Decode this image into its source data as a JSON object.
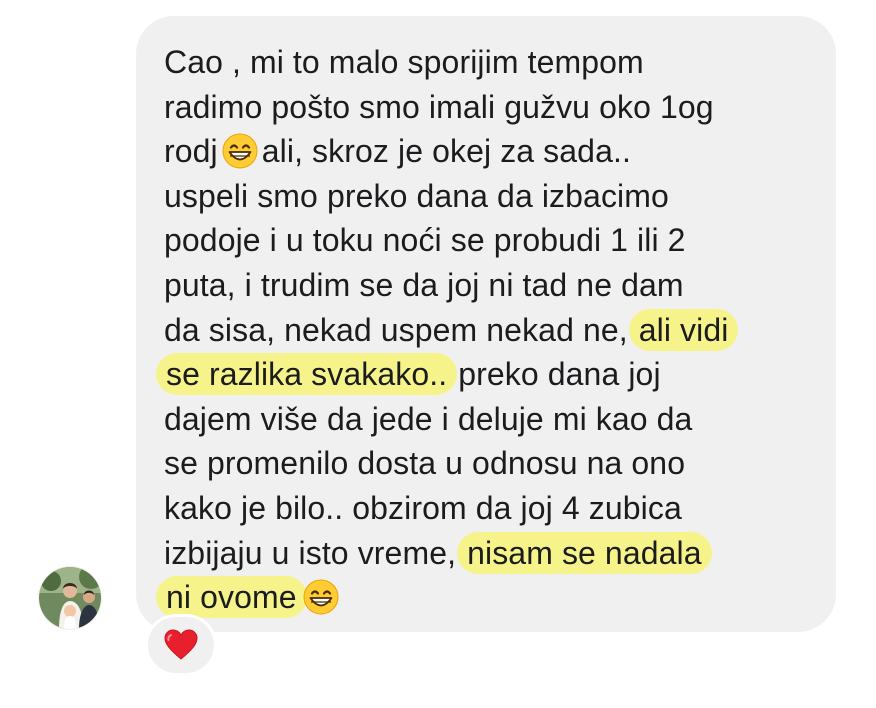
{
  "message": {
    "lines": [
      {
        "before": "Cao , mi to malo sporijim  tempom"
      },
      {
        "before": "radimo pošto smo imali gužvu oko 1og"
      },
      {
        "before": "rodj",
        "emoji": "grinning-face-emoji",
        "after": "ali, skroz je okej za sada.."
      },
      {
        "before": "uspeli smo preko dana da izbacimo"
      },
      {
        "before": "podoje  i u toku noći  se probudi 1 ili 2"
      },
      {
        "before": "puta, i trudim  se da joj ni tad ne dam"
      },
      {
        "before": "da sisa, nekad uspem nekad ne,",
        "highlight": "ali vidi"
      },
      {
        "highlight": "se razlika svakako..",
        "after": "preko dana joj"
      },
      {
        "before": "dajem više da jede i deluje mi kao da"
      },
      {
        "before": "se promenilo dosta u odnosu  na ono"
      },
      {
        "before": "kako je bilo.. obzirom da joj 4 zubica"
      },
      {
        "before": "izbijaju u isto vreme,",
        "highlight": "nisam se nadala"
      },
      {
        "highlight": "ni ovome",
        "emoji": "grinning-face-emoji"
      }
    ]
  },
  "reaction": {
    "icon": "heart-icon",
    "color": "#e8202e"
  },
  "colors": {
    "bubble": "#f0f0f1",
    "highlight": "#f6f38a",
    "text": "#1c1c1e"
  }
}
